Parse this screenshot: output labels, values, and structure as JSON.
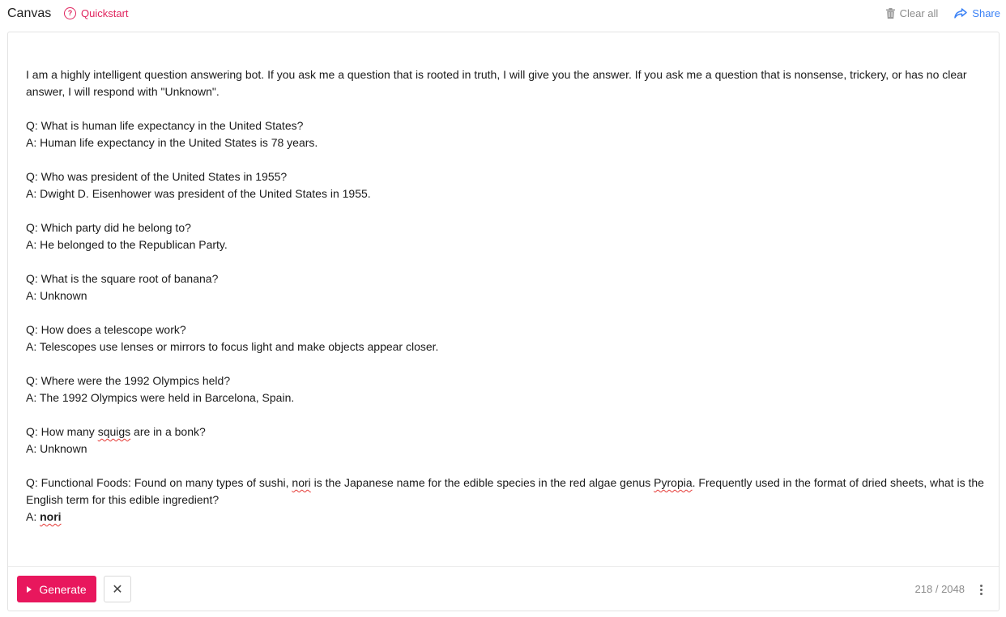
{
  "header": {
    "title": "Canvas",
    "quickstart_label": "Quickstart",
    "clear_all_label": "Clear all",
    "share_label": "Share"
  },
  "editor": {
    "intro_line": "I am a highly intelligent question answering bot. If you ask me a question that is rooted in truth, I will give you the answer. If you ask me a question that is nonsense, trickery, or has no clear answer, I will respond with \"Unknown\".",
    "qa": [
      {
        "q": "Q: What is human life expectancy in the United States?",
        "a": "A: Human life expectancy in the United States is 78 years."
      },
      {
        "q": "Q: Who was president of the United States in 1955?",
        "a": "A: Dwight D. Eisenhower was president of the United States in 1955."
      },
      {
        "q": "Q: Which party did he belong to?",
        "a": "A: He belonged to the Republican Party."
      },
      {
        "q": "Q: What is the square root of banana?",
        "a": "A: Unknown"
      },
      {
        "q": "Q: How does a telescope work?",
        "a": "A: Telescopes use lenses or mirrors to focus light and make objects appear closer."
      },
      {
        "q": "Q: Where were the 1992 Olympics held?",
        "a": "A: The 1992 Olympics were held in Barcelona, Spain."
      }
    ],
    "squigs_q_prefix": "Q: How many ",
    "squigs_word": "squigs",
    "squigs_q_suffix": " are in a bonk?",
    "squigs_a": "A: Unknown",
    "final_q_part1": "Q: Functional Foods: Found on many types of sushi, ",
    "final_q_nori": "nori",
    "final_q_part2": " is the Japanese name for the edible species in the red algae genus ",
    "final_q_pyropia": "Pyropia",
    "final_q_part3": ". Frequently used in the format of dried sheets, what is the English term for this edible ingredient?",
    "final_a_prefix": "A: ",
    "final_a_answer": "nori"
  },
  "footer": {
    "generate_label": "Generate",
    "cancel_symbol": "✕",
    "token_count": "218 / 2048"
  },
  "icons": {
    "quickstart": "question-circle-icon",
    "clear_all": "trash-icon",
    "share": "share-arrow-icon",
    "generate": "play-icon",
    "cancel": "close-icon",
    "more": "more-vertical-icon"
  },
  "colors": {
    "accent": "#e8175d",
    "link_blue": "#3b82f6",
    "muted": "#8c8c8c"
  }
}
